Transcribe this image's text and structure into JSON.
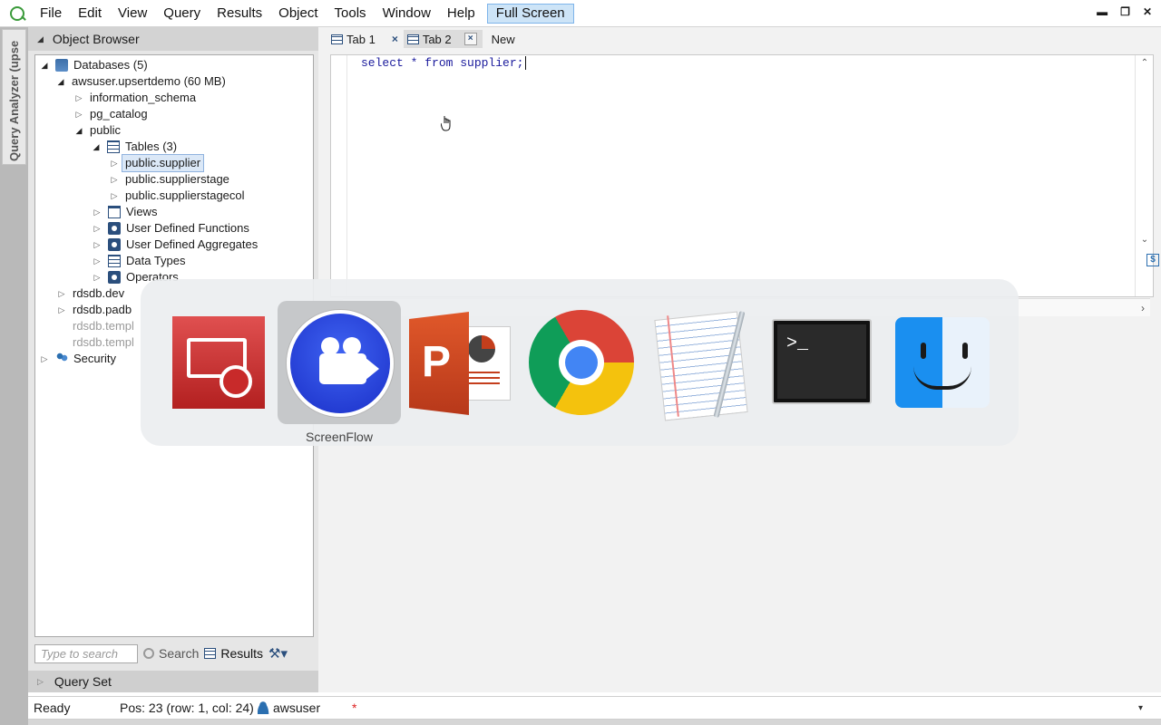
{
  "menubar": {
    "items": [
      "File",
      "Edit",
      "View",
      "Query",
      "Results",
      "Object",
      "Tools",
      "Window",
      "Help"
    ],
    "fullscreen": "Full Screen"
  },
  "side_tab": "Query Analyzer (upse",
  "object_browser": {
    "title": "Object Browser",
    "tree": {
      "databases": "Databases (5)",
      "db_main": "awsuser.upsertdemo (60 MB)",
      "schema_info": "information_schema",
      "schema_pg": "pg_catalog",
      "schema_public": "public",
      "tables": "Tables (3)",
      "table_1": "public.supplier",
      "table_2": "public.supplierstage",
      "table_3": "public.supplierstagecol",
      "views": "Views",
      "udf": "User Defined Functions",
      "uda": "User Defined Aggregates",
      "datatypes": "Data Types",
      "operators": "Operators",
      "db_2": "rdsdb.dev",
      "db_3": "rdsdb.padb",
      "db_4": "rdsdb.templ",
      "db_5": "rdsdb.templ",
      "security": "Security"
    },
    "search_placeholder": "Type to search",
    "search_button": "Search",
    "results_button": "Results"
  },
  "query_set": "Query Set",
  "tabs": {
    "tab1": "Tab 1",
    "tab2": "Tab 2",
    "new": "New",
    "close_glyph": "×"
  },
  "editor": {
    "code": "select * from supplier;",
    "scroll_glyph": "$"
  },
  "switcher": {
    "apps": [
      "Microsoft Remote Desktop",
      "ScreenFlow",
      "Microsoft PowerPoint",
      "Google Chrome",
      "TextEdit",
      "Terminal",
      "Finder"
    ],
    "selected_label": "ScreenFlow",
    "selected_index": 1,
    "terminal_prompt": ">_",
    "powerpoint_letter": "P"
  },
  "statusbar": {
    "status": "Ready",
    "position": "Pos: 23 (row: 1, col: 24)",
    "user": "awsuser",
    "modified": "*"
  },
  "colors": {
    "accent": "#2b4f7d",
    "selection": "#dbe8f7",
    "fullscreen_bg": "#cde4f7",
    "sql_keyword": "#1a1a9c"
  }
}
